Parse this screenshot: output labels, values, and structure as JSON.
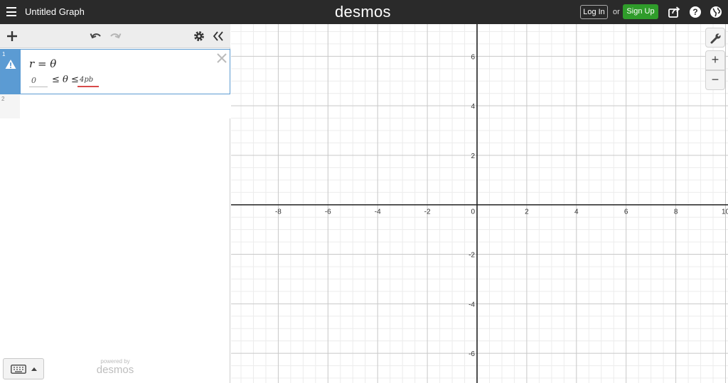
{
  "topbar": {
    "title": "Untitled Graph",
    "brand": "desmos",
    "login_label": "Log In",
    "or_label": "or",
    "signup_label": "Sign Up",
    "icons": [
      "hamburger-icon",
      "share-icon",
      "help-icon",
      "language-icon"
    ]
  },
  "panel": {
    "icons": [
      "add-icon",
      "undo-icon",
      "redo-icon",
      "settings-icon",
      "collapse-icon"
    ],
    "expressions": [
      {
        "index": "1",
        "latex": "r = θ",
        "status": "warning",
        "domain_low": "0",
        "domain_mid": "≤ θ ≤",
        "domain_high": "4pb"
      },
      {
        "index": "2",
        "latex": ""
      }
    ],
    "powered_by": "powered by",
    "powered_brand": "desmos"
  },
  "graph": {
    "x_ticks": [
      "-8",
      "-6",
      "-4",
      "-2",
      "0",
      "2",
      "4",
      "6",
      "8",
      "10"
    ],
    "y_ticks": [
      "6",
      "4",
      "2",
      "-2",
      "-4",
      "-6"
    ],
    "xlim": [
      -9.9,
      10.1
    ],
    "ylim": [
      -7.2,
      7.3
    ],
    "minor_step": 0.5,
    "major_step": 2,
    "colors": {
      "axis": "#222222",
      "major": "#c8c8c8",
      "minor": "#ececec",
      "accent": "#5b9bd3",
      "signup": "#2f9c2a",
      "error": "#d84b4b"
    },
    "controls": [
      "wrench-icon",
      "zoom-in",
      "zoom-out"
    ],
    "zoom_in_label": "+",
    "zoom_out_label": "−"
  }
}
